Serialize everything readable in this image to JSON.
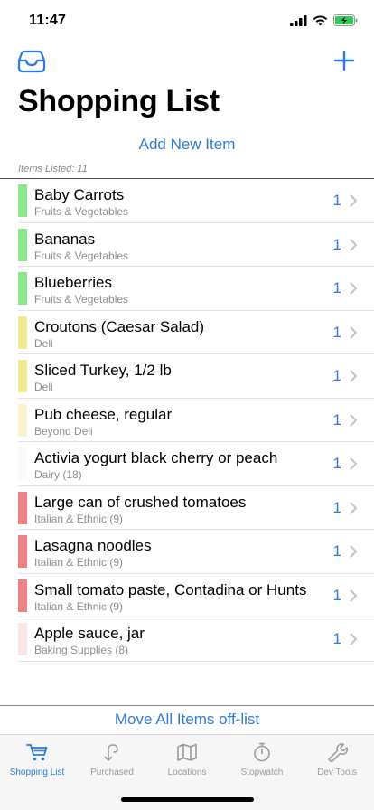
{
  "status_bar": {
    "time": "11:47"
  },
  "header": {
    "title": "Shopping List",
    "add_new_label": "Add New Item",
    "items_listed": "Items Listed: 11"
  },
  "items": [
    {
      "name": "Baby Carrots",
      "category": "Fruits & Vegetables",
      "qty": "1",
      "color": "#8ee68a"
    },
    {
      "name": "Bananas",
      "category": "Fruits & Vegetables",
      "qty": "1",
      "color": "#8ee68a"
    },
    {
      "name": "Blueberries",
      "category": "Fruits & Vegetables",
      "qty": "1",
      "color": "#8ee68a"
    },
    {
      "name": "Croutons (Caesar Salad)",
      "category": "Deli",
      "qty": "1",
      "color": "#f2ea92"
    },
    {
      "name": "Sliced Turkey, 1/2 lb",
      "category": "Deli",
      "qty": "1",
      "color": "#f2ea92"
    },
    {
      "name": "Pub cheese, regular",
      "category": "Beyond Deli",
      "qty": "1",
      "color": "#f7f3cf"
    },
    {
      "name": "Activia yogurt black cherry or peach",
      "category": "Dairy (18)",
      "qty": "1",
      "color": "#fafafa"
    },
    {
      "name": "Large can of crushed tomatoes",
      "category": "Italian & Ethnic (9)",
      "qty": "1",
      "color": "#eb8585"
    },
    {
      "name": "Lasagna noodles",
      "category": "Italian & Ethnic (9)",
      "qty": "1",
      "color": "#eb8585"
    },
    {
      "name": "Small tomato paste, Contadina or Hunts",
      "category": "Italian & Ethnic (9)",
      "qty": "1",
      "color": "#eb8585"
    },
    {
      "name": "Apple sauce, jar",
      "category": "Baking Supplies (8)",
      "qty": "1",
      "color": "#fbe5e5"
    }
  ],
  "footer": {
    "move_all_label": "Move All Items off-list"
  },
  "tabs": [
    {
      "label": "Shopping List",
      "icon": "cart-icon",
      "active": true
    },
    {
      "label": "Purchased",
      "icon": "purchased-arrow-icon",
      "active": false
    },
    {
      "label": "Locations",
      "icon": "map-icon",
      "active": false
    },
    {
      "label": "Stopwatch",
      "icon": "stopwatch-icon",
      "active": false
    },
    {
      "label": "Dev Tools",
      "icon": "wrench-icon",
      "active": false
    }
  ],
  "colors": {
    "accent": "#2f7bd8",
    "inactive": "#9a9a9e"
  }
}
